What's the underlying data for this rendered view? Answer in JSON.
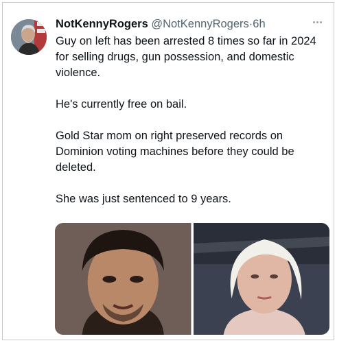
{
  "tweet": {
    "display_name": "NotKennyRogers",
    "handle": "@NotKennyRogers",
    "separator": "·",
    "time": "6h",
    "paragraphs": [
      "Guy on left has been arrested 8 times so far in 2024 for selling drugs, gun possession, and domestic violence.",
      "He's currently free on bail.",
      "Gold Star mom on right preserved records on Dominion voting machines before they could be deleted.",
      "She was just sentenced to 9 years."
    ],
    "avatar_icon": "profile-photo-bearded-man",
    "more_icon": "more-options-icon"
  },
  "media": [
    {
      "icon": "mugshot-photo"
    },
    {
      "icon": "woman-white-hair-photo"
    }
  ],
  "colors": {
    "text": "#0f1419",
    "secondary": "#536471",
    "border": "#c9c9c9"
  }
}
